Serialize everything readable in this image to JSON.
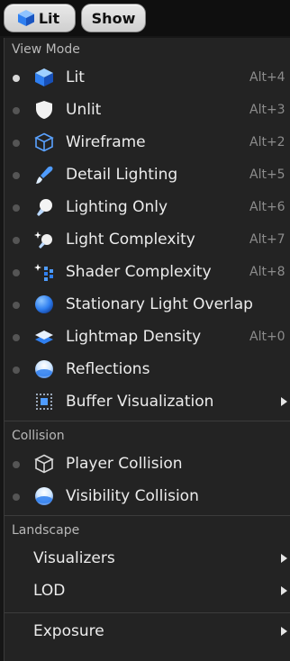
{
  "toolbar": {
    "lit_label": "Lit",
    "show_label": "Show"
  },
  "menu": {
    "view_mode": {
      "header": "View Mode",
      "items": [
        {
          "label": "Lit",
          "shortcut": "Alt+4",
          "icon": "cube-lit-icon",
          "selected": true
        },
        {
          "label": "Unlit",
          "shortcut": "Alt+3",
          "icon": "shield-icon"
        },
        {
          "label": "Wireframe",
          "shortcut": "Alt+2",
          "icon": "wireframe-cube-icon"
        },
        {
          "label": "Detail Lighting",
          "shortcut": "Alt+5",
          "icon": "brush-icon"
        },
        {
          "label": "Lighting Only",
          "shortcut": "Alt+6",
          "icon": "bulb-icon"
        },
        {
          "label": "Light Complexity",
          "shortcut": "Alt+7",
          "icon": "light-complexity-icon"
        },
        {
          "label": "Shader Complexity",
          "shortcut": "Alt+8",
          "icon": "shader-complexity-icon"
        },
        {
          "label": "Stationary Light Overlap",
          "shortcut": "",
          "icon": "blue-sphere-icon"
        },
        {
          "label": "Lightmap Density",
          "shortcut": "Alt+0",
          "icon": "layers-icon"
        },
        {
          "label": "Reflections",
          "shortcut": "",
          "icon": "reflection-sphere-icon"
        },
        {
          "label": "Buffer Visualization",
          "shortcut": "",
          "icon": "grid-dots-icon",
          "submenu": true
        }
      ]
    },
    "collision": {
      "header": "Collision",
      "items": [
        {
          "label": "Player Collision",
          "icon": "wireframe-cube-icon"
        },
        {
          "label": "Visibility Collision",
          "icon": "reflection-sphere-icon"
        }
      ]
    },
    "landscape": {
      "header": "Landscape",
      "items": [
        {
          "label": "Visualizers",
          "submenu": true
        },
        {
          "label": "LOD",
          "submenu": true
        }
      ]
    },
    "exposure": {
      "label": "Exposure",
      "submenu": true
    }
  },
  "colors": {
    "background": "#232323",
    "accent_blue": "#2f7ff0",
    "text": "#ececec",
    "shortcut": "#8c8c8c"
  }
}
